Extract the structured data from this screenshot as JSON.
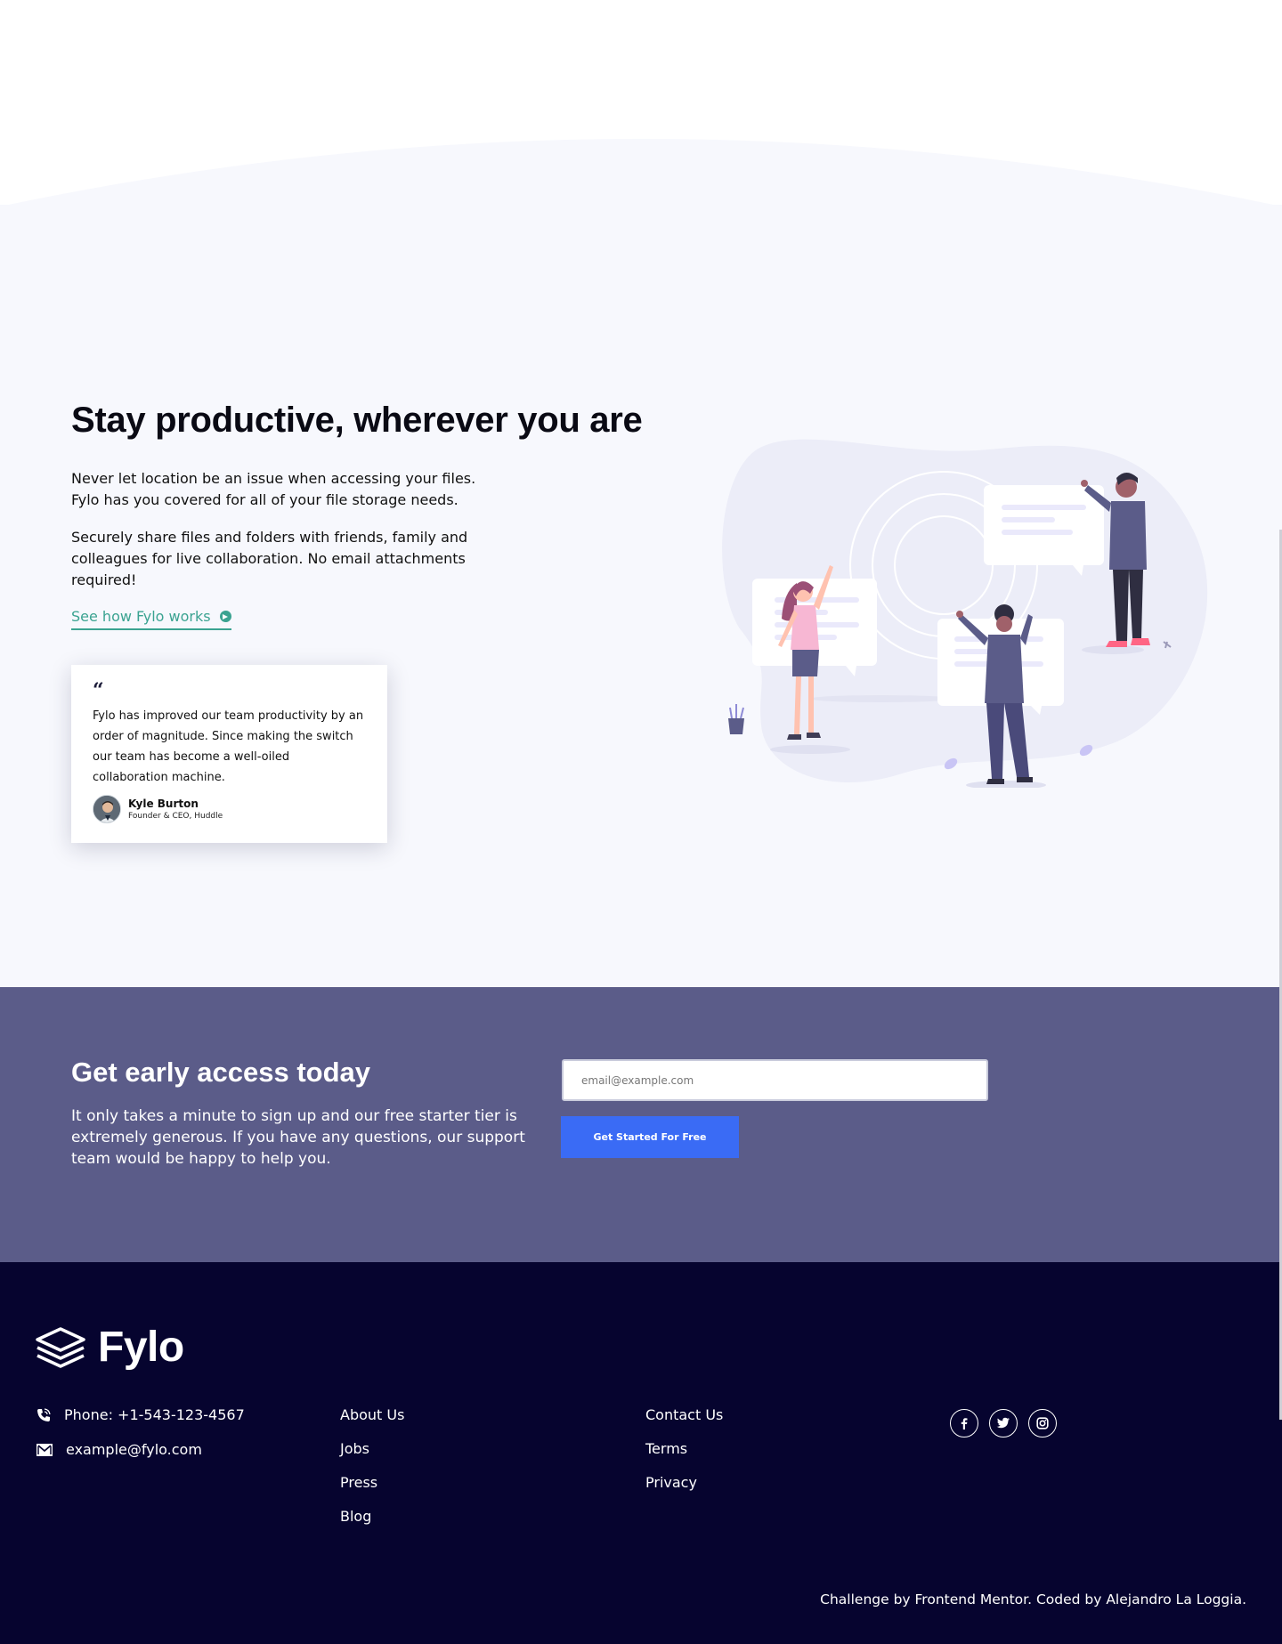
{
  "productive": {
    "title": "Stay productive, wherever you are",
    "paragraph_1": "Never let location be an issue when accessing your files. Fylo has you covered for all of your file storage needs.",
    "paragraph_2": "Securely share files and folders with friends, family and colleagues for live collaboration. No email attachments required!",
    "link_label": "See how Fylo works",
    "link_icon": "arrow-right-circle-icon"
  },
  "testimonial": {
    "quote_mark": "“",
    "quote": "Fylo has improved our team productivity by an order of magnitude. Since making the switch our team has become a well-oiled collaboration machine.",
    "author_name": "Kyle Burton",
    "author_role": "Founder & CEO, Huddle"
  },
  "early_access": {
    "title": "Get early access today",
    "text": "It only takes a minute to sign up and our free starter tier is extremely generous. If you have any questions, our support team would be happy to help you.",
    "email_placeholder": "email@example.com",
    "button_label": "Get Started For Free"
  },
  "footer": {
    "logo_text": "Fylo",
    "phone": "Phone: +1-543-123-4567",
    "email": "example@fylo.com",
    "links_col1": [
      "About Us",
      "Jobs",
      "Press",
      "Blog"
    ],
    "links_col2": [
      "Contact Us",
      "Terms",
      "Privacy"
    ],
    "social": [
      "facebook-icon",
      "twitter-icon",
      "instagram-icon"
    ],
    "credits": "Challenge by Frontend Mentor. Coded by Alejandro La Loggia."
  },
  "colors": {
    "accent_teal": "#3ba391",
    "cta_blue": "#3a6bf5",
    "early_bg": "#5b5c89",
    "footer_bg": "#06042f",
    "section_bg": "#f7f8fd"
  }
}
